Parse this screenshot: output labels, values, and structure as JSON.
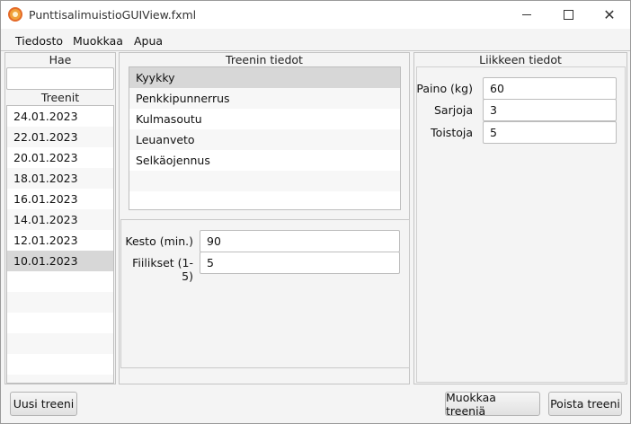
{
  "window": {
    "title": "PunttisalimuistioGUIView.fxml"
  },
  "menu": [
    "Tiedosto",
    "Muokkaa",
    "Apua"
  ],
  "left": {
    "search_label": "Hae",
    "search_value": "",
    "list_label": "Treenit",
    "workouts": [
      "24.01.2023",
      "22.01.2023",
      "20.01.2023",
      "18.01.2023",
      "16.01.2023",
      "14.01.2023",
      "12.01.2023",
      "10.01.2023"
    ],
    "selected_index": 7
  },
  "middle": {
    "title": "Treenin tiedot",
    "exercises": [
      "Kyykky",
      "Penkkipunnerrus",
      "Kulmasoutu",
      "Leuanveto",
      "Selkäojennus"
    ],
    "selected_index": 0,
    "fields": [
      {
        "label": "Kesto (min.)",
        "value": "90"
      },
      {
        "label": "Fiilikset (1-5)",
        "value": "5"
      }
    ]
  },
  "right": {
    "title": "Liikkeen tiedot",
    "fields": [
      {
        "label": "Paino (kg)",
        "value": "60"
      },
      {
        "label": "Sarjoja",
        "value": "3"
      },
      {
        "label": "Toistoja",
        "value": "5"
      }
    ]
  },
  "buttons": {
    "new": "Uusi treeni",
    "edit": "Muokkaa treeniä",
    "delete": "Poista treeni"
  }
}
